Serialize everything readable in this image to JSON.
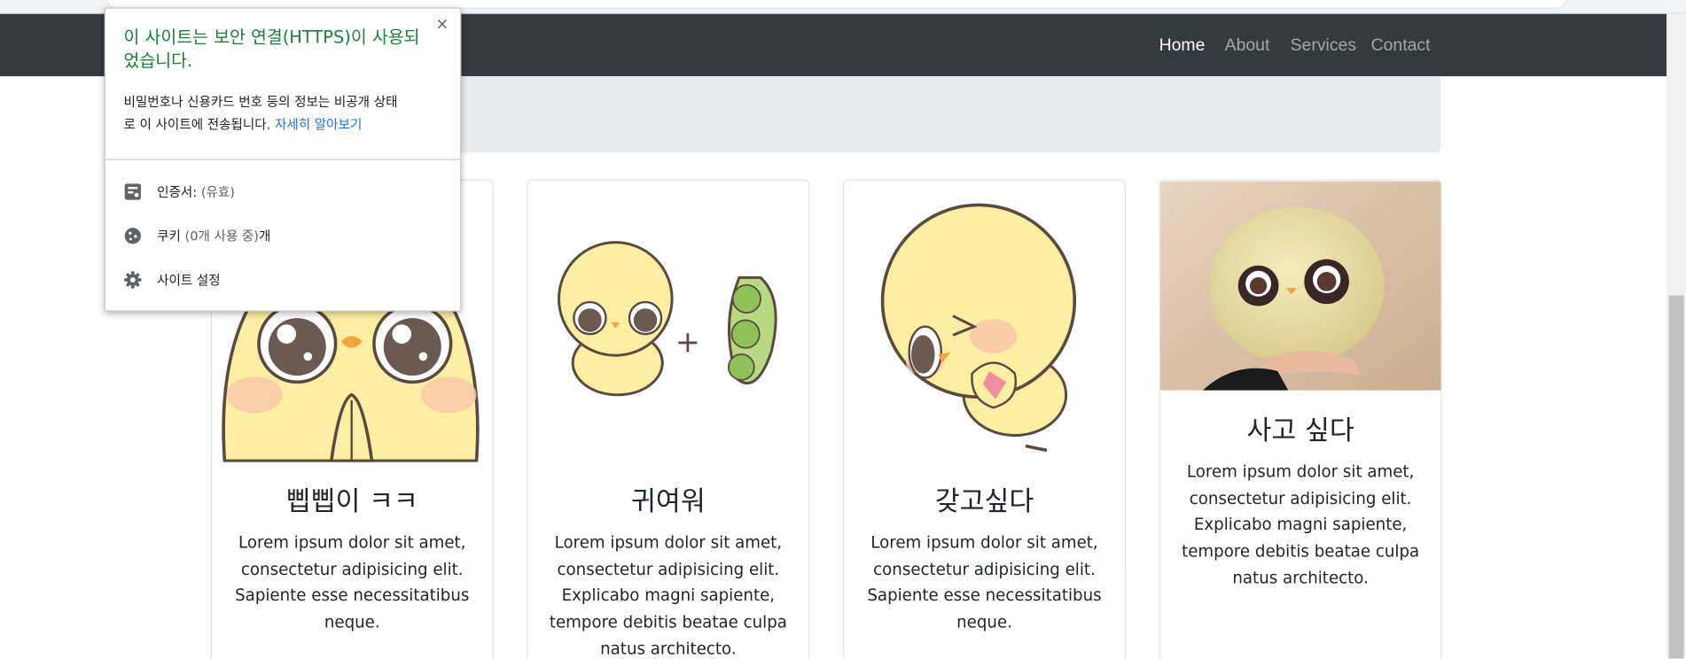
{
  "navbar": {
    "items": [
      {
        "label": "Home",
        "active": true
      },
      {
        "label": "About",
        "active": false
      },
      {
        "label": "Services",
        "active": false
      },
      {
        "label": "Contact",
        "active": false
      }
    ]
  },
  "cards": [
    {
      "title": "삡삡이 ㅋㅋ",
      "text_lines": [
        "Lorem ipsum dolor sit amet,",
        "consectetur adipisicing elit.",
        "Sapiente esse necessitatibus",
        "neque."
      ]
    },
    {
      "title": "귀여워",
      "text_lines": [
        "Lorem ipsum dolor sit amet,",
        "consectetur adipisicing elit.",
        "Explicabo magni sapiente,",
        "tempore debitis beatae culpa",
        "natus architecto."
      ]
    },
    {
      "title": "갖고싶다",
      "text_lines": [
        "Lorem ipsum dolor sit amet,",
        "consectetur adipisicing elit.",
        "Sapiente esse necessitatibus",
        "neque."
      ]
    },
    {
      "title": "사고 싶다",
      "text_lines": [
        "Lorem ipsum dolor sit amet,",
        "consectetur adipisicing elit.",
        "Explicabo magni sapiente,",
        "tempore debitis beatae culpa",
        "natus architecto."
      ]
    }
  ],
  "popup": {
    "close_glyph": "×",
    "title_lines": [
      "이 사이트는 보안 연결(HTTPS)이 사용되",
      "었습니다."
    ],
    "desc_lines": [
      "비밀번호나 신용카드 번호 등의 정보는 비공개 상태",
      "로 이 사이트에 전송됩니다."
    ],
    "learn_more": "자세히 알아보기",
    "rows": [
      {
        "icon": "certificate-icon",
        "label": "인증서:",
        "muted": "(유효)"
      },
      {
        "icon": "cookie-icon",
        "label": "쿠키",
        "muted": "(0개 사용 중)",
        "suffix": "개"
      },
      {
        "icon": "gear-icon",
        "label": "사이트 설정",
        "muted": ""
      }
    ]
  },
  "colors": {
    "navbar_bg": "#343a40",
    "jumbotron_bg": "#e9ecef",
    "secure_green": "#188038",
    "link_blue": "#1a73e8",
    "chick_yellow": "#fdeea4"
  }
}
